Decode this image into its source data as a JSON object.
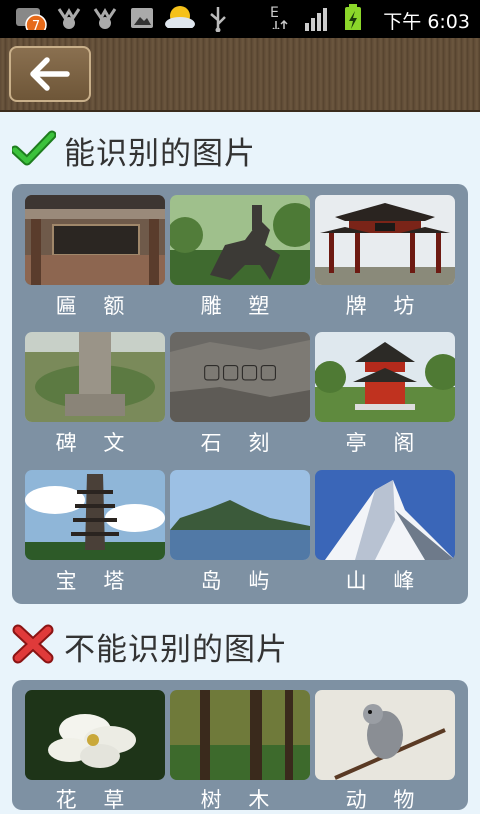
{
  "status_bar": {
    "time": "下午 6:03",
    "notification_count": "7",
    "network_type": "E",
    "icons": [
      "notification-badge-icon",
      "award-icon",
      "award-icon",
      "image-icon",
      "weather-icon",
      "usb-icon",
      "data-arrows-icon",
      "signal-icon",
      "battery-charging-icon"
    ]
  },
  "toolbar": {
    "back_icon": "arrow-left-icon"
  },
  "recognizable": {
    "title": "能识别的图片",
    "icon": "green-checkmark-icon",
    "items": [
      {
        "label": "匾 额",
        "image": "plaque-gate"
      },
      {
        "label": "雕 塑",
        "image": "horse-statue"
      },
      {
        "label": "牌 坊",
        "image": "memorial-archway"
      },
      {
        "label": "碑 文",
        "image": "stone-tablet"
      },
      {
        "label": "石 刻",
        "image": "rock-carving"
      },
      {
        "label": "亭 阁",
        "image": "pavilion"
      },
      {
        "label": "宝 塔",
        "image": "pagoda"
      },
      {
        "label": "岛 屿",
        "image": "island"
      },
      {
        "label": "山 峰",
        "image": "mountain-peak"
      }
    ]
  },
  "unrecognizable": {
    "title": "不能识别的图片",
    "icon": "red-x-icon",
    "items": [
      {
        "label": "花 草",
        "image": "magnolia-flower"
      },
      {
        "label": "树 木",
        "image": "trees"
      },
      {
        "label": "动 物",
        "image": "bird"
      }
    ]
  },
  "colors": {
    "page_bg": "#e9f4fb",
    "panel_bg": "#7e91a3",
    "toolbar": "#5e4a35",
    "check": "#2fa52f",
    "cross": "#d33030"
  }
}
